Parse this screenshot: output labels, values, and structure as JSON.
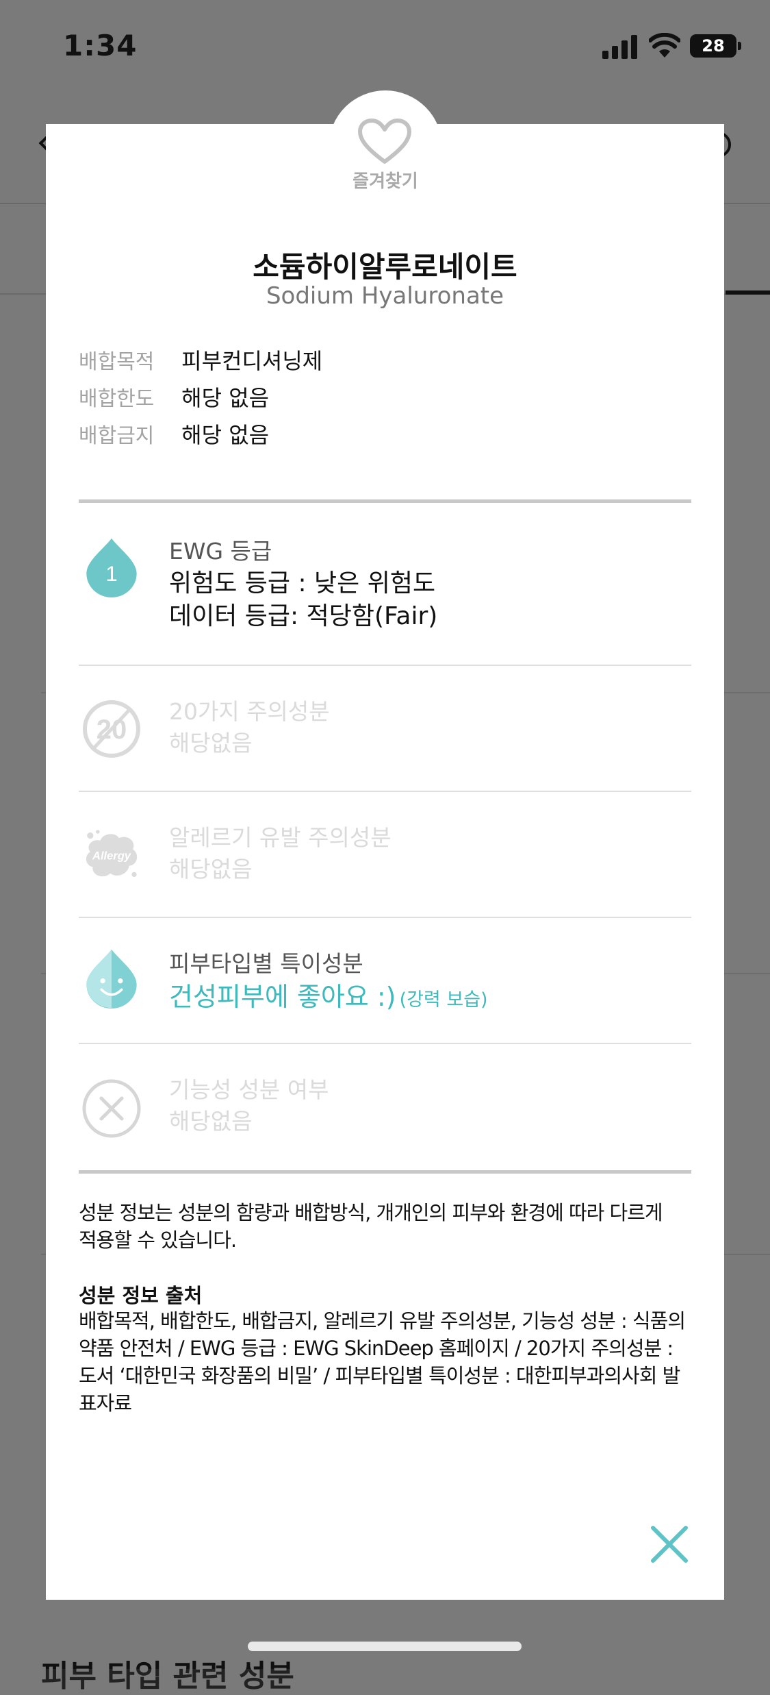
{
  "status_bar": {
    "time": "1:34",
    "battery": "28"
  },
  "background": {
    "bottom_title": "피부 타입 관련 성분"
  },
  "modal": {
    "favorite_label": "즐겨찾기",
    "ingredient_name_ko": "소듐하이알루로네이트",
    "ingredient_name_en": "Sodium Hyaluronate",
    "properties": [
      {
        "label": "배합목적",
        "value": "피부컨디셔닝제"
      },
      {
        "label": "배합한도",
        "value": "해당 없음"
      },
      {
        "label": "배합금지",
        "value": "해당 없음"
      }
    ],
    "ewg": {
      "title": "EWG 등급",
      "grade": "1",
      "hazard": "위험도 등급 : 낮은 위험도",
      "data": "데이터 등급: 적당함(Fair)"
    },
    "caution20": {
      "icon_text": "20",
      "title": "20가지 주의성분",
      "value": "해당없음"
    },
    "allergy": {
      "icon_text": "Allergy",
      "title": "알레르기 유발 주의성분",
      "value": "해당없음"
    },
    "skin_type": {
      "title": "피부타입별 특이성분",
      "main": "건성피부에 좋아요 :)",
      "note": "(강력 보습)"
    },
    "functional": {
      "title": "기능성 성분 여부",
      "value": "해당없음"
    },
    "note": "성분 정보는 성분의 함량과 배합방식, 개개인의 피부와 환경에 따라 다르게 적용할 수 있습니다.",
    "source_title": "성분 정보 출처",
    "source_body": "배합목적, 배합한도, 배합금지, 알레르기 유발 주의성분, 기능성 성분 : 식품의약품 안전처 / EWG 등급 : EWG SkinDeep 홈페이지 / 20가지 주의성분 : 도서 ‘대한민국 화장품의 비밀’ / 피부타입별 특이성분 : 대한피부과의사회 발표자료"
  },
  "colors": {
    "accent_teal": "#3fb9bc",
    "faded_gray": "#dadada",
    "overlay": "#7a7a7a"
  }
}
